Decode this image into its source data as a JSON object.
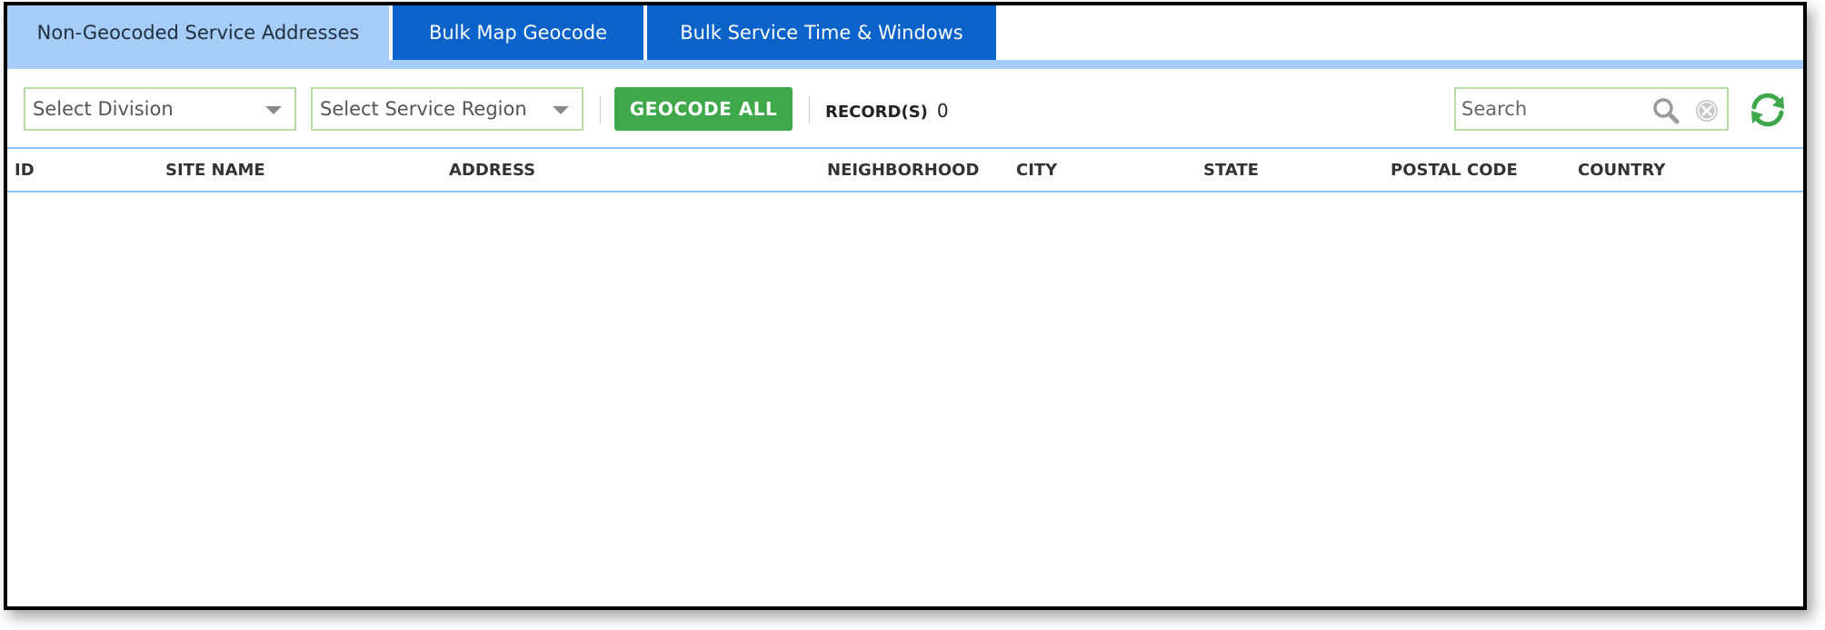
{
  "tabs": [
    {
      "label": "Non-Geocoded Service Addresses",
      "active": true
    },
    {
      "label": "Bulk Map Geocode",
      "active": false
    },
    {
      "label": "Bulk Service Time & Windows",
      "active": false
    }
  ],
  "toolbar": {
    "division_select": {
      "value": "Select Division"
    },
    "region_select": {
      "value": "Select Service Region"
    },
    "geocode_all_label": "GEOCODE ALL",
    "records_label": "RECORD(S)",
    "records_count": "0",
    "search": {
      "placeholder": "Search",
      "value": ""
    },
    "icons": [
      "search-icon",
      "clear-icon",
      "refresh-icon"
    ]
  },
  "grid": {
    "columns": [
      "ID",
      "SITE NAME",
      "ADDRESS",
      "NEIGHBORHOOD",
      "CITY",
      "STATE",
      "POSTAL CODE",
      "COUNTRY"
    ],
    "rows": []
  },
  "colors": {
    "active_tab": "#a6cdf7",
    "inactive_tab": "#0b63c9",
    "primary_button": "#3ea84a",
    "field_border": "#b8dca4",
    "refresh_icon": "#3ea84a"
  }
}
